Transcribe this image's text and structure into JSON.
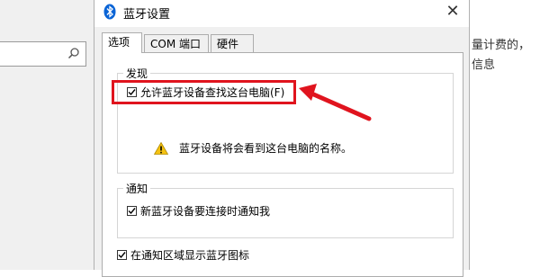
{
  "background": {
    "right_text": "量计费的，信息"
  },
  "dialog": {
    "title": "蓝牙设置",
    "close_glyph": "✕",
    "tabs": [
      {
        "label": "选项",
        "active": true
      },
      {
        "label": "COM 端口",
        "active": false
      },
      {
        "label": "硬件",
        "active": false
      }
    ],
    "discovery": {
      "legend": "发现",
      "allow_discover_label": "允许蓝牙设备查找这台电脑(F)",
      "allow_discover_checked": true,
      "warning_text": "蓝牙设备将会看到这台电脑的名称。"
    },
    "notifications": {
      "legend": "通知",
      "notify_new_device_label": "新蓝牙设备要连接时通知我",
      "notify_new_device_checked": true
    },
    "show_tray_icon_label": "在通知区域显示蓝牙图标",
    "show_tray_icon_checked": true
  },
  "annotation": {
    "highlight_color": "#e0141e"
  },
  "icons": {
    "search": "search-icon",
    "bluetooth": "bluetooth-icon",
    "warning": "warning-icon",
    "checkmark": "checkmark-icon"
  }
}
